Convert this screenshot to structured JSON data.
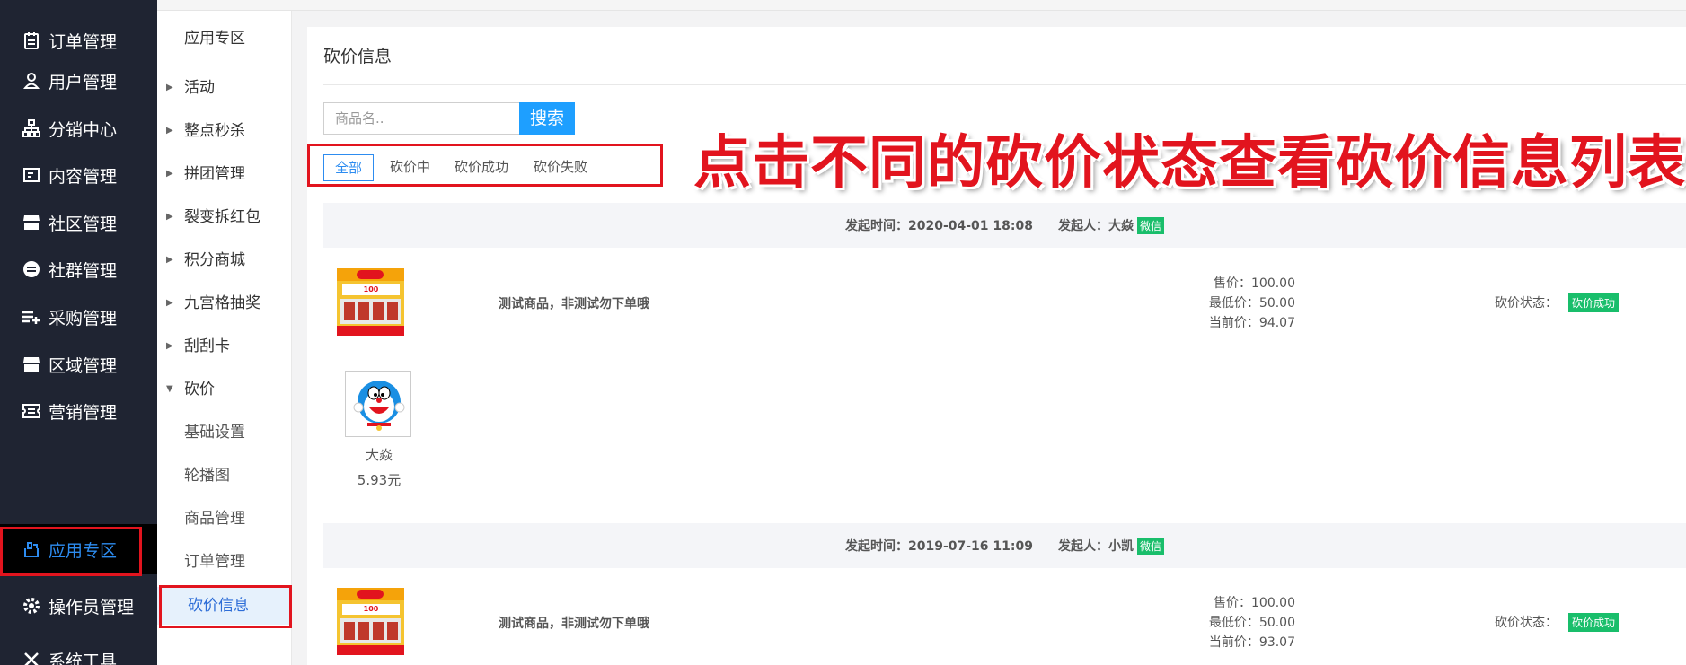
{
  "sidebar": {
    "items": [
      {
        "label": "订单管理",
        "icon": "clipboard-icon"
      },
      {
        "label": "用户管理",
        "icon": "user-icon"
      },
      {
        "label": "分销中心",
        "icon": "network-icon"
      },
      {
        "label": "内容管理",
        "icon": "content-icon"
      },
      {
        "label": "社区管理",
        "icon": "store-icon"
      },
      {
        "label": "社群管理",
        "icon": "minus-circle-icon"
      },
      {
        "label": "采购管理",
        "icon": "list-add-icon"
      },
      {
        "label": "区域管理",
        "icon": "shop-icon"
      },
      {
        "label": "营销管理",
        "icon": "ticket-icon"
      },
      {
        "label": "应用专区",
        "icon": "app-icon",
        "active": true
      },
      {
        "label": "操作员管理",
        "icon": "gear-icon"
      },
      {
        "label": "系统工具",
        "icon": "tools-icon"
      }
    ]
  },
  "submenu": {
    "header": "应用专区",
    "items": [
      "活动",
      "整点秒杀",
      "拼团管理",
      "裂变拆红包",
      "积分商城",
      "九宫格抽奖",
      "刮刮卡",
      "砍价"
    ],
    "children": [
      "基础设置",
      "轮播图",
      "商品管理",
      "订单管理",
      "砍价信息"
    ],
    "current": "砍价信息"
  },
  "main": {
    "title": "砍价信息",
    "search_placeholder": "商品名..",
    "search_button": "搜索",
    "tabs": [
      "全部",
      "砍价中",
      "砍价成功",
      "砍价失败"
    ],
    "callout": "点击不同的砍价状态查看砍价信息列表"
  },
  "records": [
    {
      "time_label": "发起时间：2020-04-01 18:08",
      "initiator_label": "发起人：大焱",
      "channel": "微信",
      "product": "测试商品，非测试勿下单哦",
      "price": "售价：100.00",
      "min_price": "最低价：50.00",
      "current_price": "当前价：94.07",
      "status_label": "砍价状态：",
      "status": "砍价成功",
      "helper_name": "大焱",
      "helper_amount": "5.93元"
    },
    {
      "time_label": "发起时间：2019-07-16 11:09",
      "initiator_label": "发起人：小凯",
      "channel": "微信",
      "product": "测试商品，非测试勿下单哦",
      "price": "售价：100.00",
      "min_price": "最低价：50.00",
      "current_price": "当前价：93.07",
      "status_label": "砍价状态：",
      "status": "砍价成功"
    }
  ],
  "colors": {
    "sidebar_bg": "#1f2432",
    "accent_blue": "#2d8cf0",
    "annotation_red": "#e2141e",
    "success_green": "#19be6b"
  }
}
